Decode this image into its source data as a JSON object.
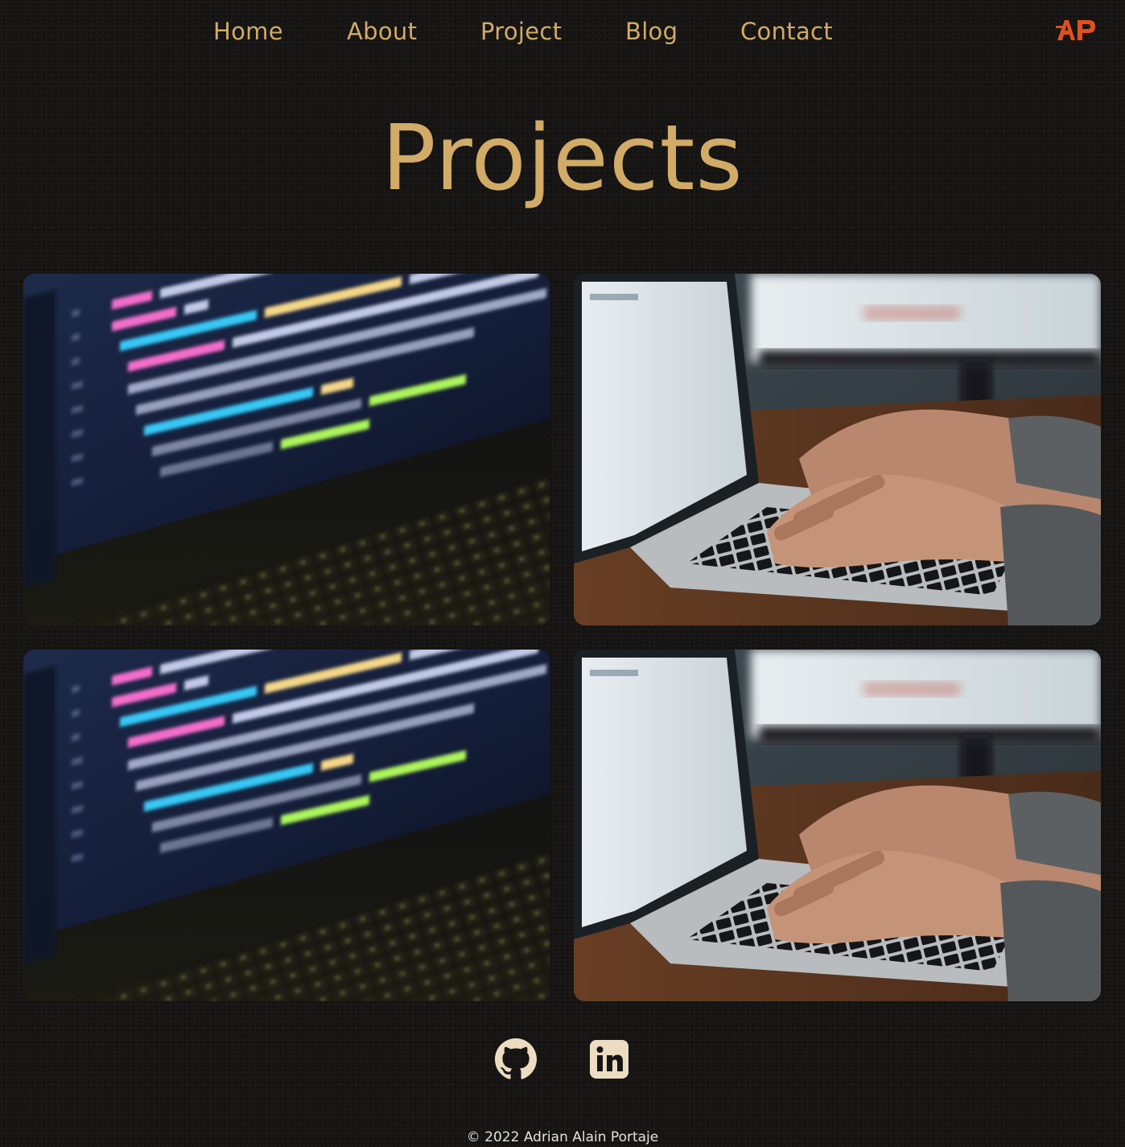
{
  "nav": {
    "items": [
      {
        "label": "Home"
      },
      {
        "label": "About"
      },
      {
        "label": "Project"
      },
      {
        "label": "Blog"
      },
      {
        "label": "Contact"
      }
    ],
    "logo_text": "AP",
    "logo_icon": "ap-logo-icon"
  },
  "page": {
    "title": "Projects"
  },
  "projects": [
    {
      "image": "code-editor-screen-photo"
    },
    {
      "image": "hands-typing-laptop-photo"
    },
    {
      "image": "code-editor-screen-photo"
    },
    {
      "image": "hands-typing-laptop-photo"
    }
  ],
  "social": {
    "items": [
      {
        "icon": "github-icon"
      },
      {
        "icon": "linkedin-icon"
      }
    ]
  },
  "footer": {
    "text": "© 2022 Adrian Alain Portaje"
  },
  "colors": {
    "background": "#161514",
    "accent_gold": "#d2ab66",
    "logo_orange": "#e0501f",
    "icon_cream": "#ecdcc2",
    "footer_text": "#e6e1d7"
  }
}
